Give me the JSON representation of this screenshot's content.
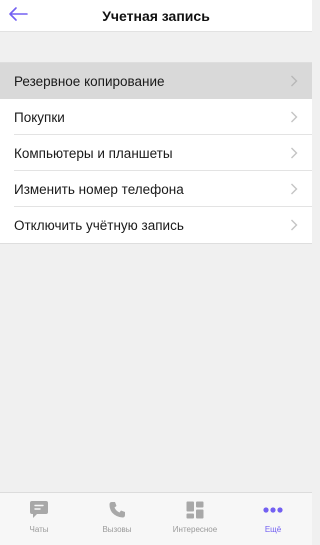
{
  "header": {
    "title": "Учетная запись"
  },
  "settings": {
    "items": [
      {
        "label": "Резервное копирование"
      },
      {
        "label": "Покупки"
      },
      {
        "label": "Компьютеры и планшеты"
      },
      {
        "label": "Изменить номер телефона"
      },
      {
        "label": "Отключить учётную запись"
      }
    ]
  },
  "tabbar": {
    "tabs": [
      {
        "label": "Чаты",
        "icon": "chat-bubble-icon"
      },
      {
        "label": "Вызовы",
        "icon": "phone-icon"
      },
      {
        "label": "Интересное",
        "icon": "explore-grid-icon"
      },
      {
        "label": "Ещё",
        "icon": "more-dots-icon"
      }
    ]
  },
  "colors": {
    "accent": "#7360f2",
    "inactive_icon": "#a8a8a8",
    "selected_row": "#d9d9d9",
    "background": "#f0f0f0"
  }
}
